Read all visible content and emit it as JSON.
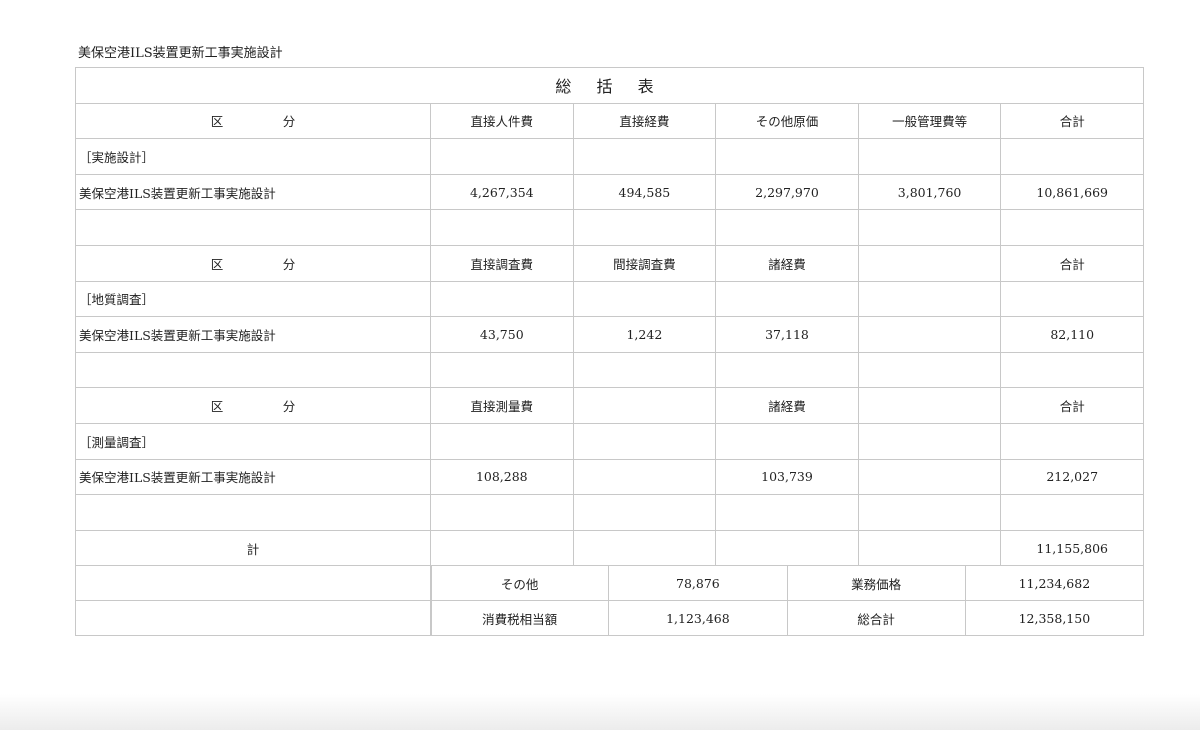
{
  "document": {
    "header": "美保空港ILS装置更新工事実施設計",
    "table_title": "総 括 表"
  },
  "section1": {
    "kubun_label_left": "区",
    "kubun_label_right": "分",
    "columns": [
      "直接人件費",
      "直接経費",
      "その他原価",
      "一般管理費等",
      "合計"
    ],
    "group_label": "［実施設計］",
    "row": {
      "name": "美保空港ILS装置更新工事実施設計",
      "values": [
        "4,267,354",
        "494,585",
        "2,297,970",
        "3,801,760",
        "10,861,669"
      ]
    }
  },
  "section2": {
    "kubun_label_left": "区",
    "kubun_label_right": "分",
    "columns": [
      "直接調査費",
      "間接調査費",
      "諸経費",
      "",
      "合計"
    ],
    "group_label": "［地質調査］",
    "row": {
      "name": "美保空港ILS装置更新工事実施設計",
      "values": [
        "43,750",
        "1,242",
        "37,118",
        "",
        "82,110"
      ]
    }
  },
  "section3": {
    "kubun_label_left": "区",
    "kubun_label_right": "分",
    "columns": [
      "直接測量費",
      "",
      "諸経費",
      "",
      "合計"
    ],
    "group_label": "［測量調査］",
    "row": {
      "name": "美保空港ILS装置更新工事実施設計",
      "values": [
        "108,288",
        "",
        "103,739",
        "",
        "212,027"
      ]
    }
  },
  "total": {
    "label": "計",
    "value": "11,155,806"
  },
  "summary": {
    "rows": [
      [
        "その他",
        "78,876",
        "業務価格",
        "11,234,682"
      ],
      [
        "消費税相当額",
        "1,123,468",
        "総合計",
        "12,358,150"
      ]
    ]
  }
}
